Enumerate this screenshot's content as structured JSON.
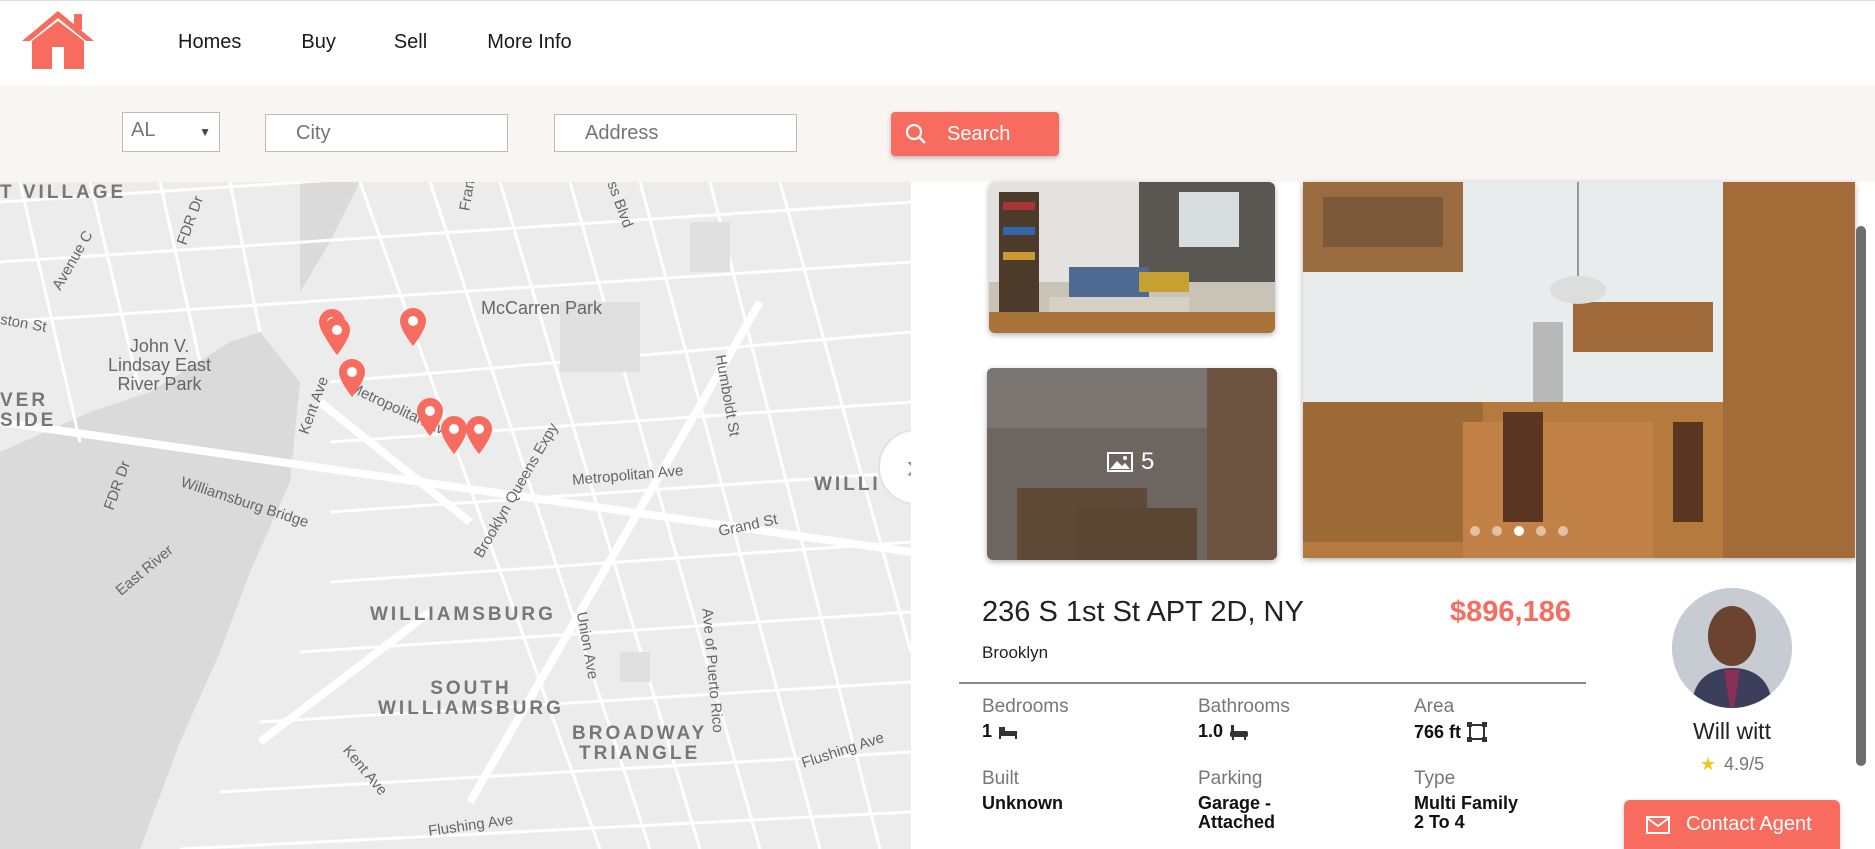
{
  "nav": {
    "logo_icon": "house-icon",
    "links": [
      "Homes",
      "Buy",
      "Sell",
      "More Info"
    ]
  },
  "search": {
    "state_value": "AL",
    "city_placeholder": "City",
    "address_placeholder": "Address",
    "button_label": "Search"
  },
  "map": {
    "labels": {
      "village": "T VILLAGE",
      "fdr1": "FDR Dr",
      "avenue_c": "Avenue C",
      "ston": "ston St",
      "lindsay": "John V.\nLindsay East\nRiver Park",
      "mccarren": "McCarren Park",
      "ver_side": "VER\nSIDE",
      "metropolitan1": "Metropolitan Ave",
      "kent": "Kent Ave",
      "fdr2": "FDR Dr",
      "wburg_bridge": "Williamsburg Bridge",
      "east_river": "East River",
      "bqe": "Brooklyn Queens Expy",
      "metropolitan2": "Metropolitan Ave",
      "humboldt": "Humboldt St",
      "grand": "Grand St",
      "willi": "WILLI",
      "williamsburg": "WILLIAMSBURG",
      "union": "Union Ave",
      "south_wburg": "SOUTH\nWILLIAMSBURG",
      "puerto_rico": "Ave of Puerto Rico",
      "broadway_triangle": "BROADWAY\nTRIANGLE",
      "kent2": "Kent Ave",
      "flushing1": "Flushing Ave",
      "flushing2": "Flushing Ave",
      "blvd": "ess Blvd",
      "fran": "Fran"
    },
    "expand_icon": "double-chevron-right-icon"
  },
  "listing": {
    "photo_count": "5",
    "address": "236 S 1st St APT 2D, NY",
    "price": "$896,186",
    "borough": "Brooklyn",
    "stats": [
      {
        "label": "Bedrooms",
        "value": "1",
        "icon": "bed-icon"
      },
      {
        "label": "Bathrooms",
        "value": "1.0",
        "icon": "bathtub-icon"
      },
      {
        "label": "Area",
        "value": "766 ft",
        "icon": "area-icon"
      },
      {
        "label": "Built",
        "value": "Unknown"
      },
      {
        "label": "Parking",
        "value": "Garage -\nAttached"
      },
      {
        "label": "Type",
        "value": "Multi Family\n2 To 4"
      }
    ]
  },
  "agent": {
    "name": "Will witt",
    "rating": "4.9/5",
    "contact_label": "Contact Agent"
  },
  "colors": {
    "accent": "#f76c5e",
    "search_bg": "#f8f5f3",
    "map_bg": "#ececec"
  }
}
